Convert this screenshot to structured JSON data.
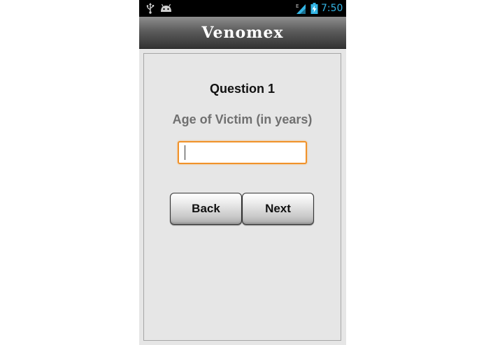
{
  "status_bar": {
    "time": "7:50",
    "icons": [
      "usb-icon",
      "android-icon",
      "signal-e-icon",
      "battery-charging-icon"
    ],
    "time_color": "#33b5e5"
  },
  "app": {
    "title": "Venomex"
  },
  "question": {
    "number": "Question 1",
    "text": "Age of Victim (in years)"
  },
  "answer_input": {
    "value": "",
    "placeholder": "",
    "focus_color": "#f0922a"
  },
  "buttons": {
    "back": "Back",
    "next": "Next"
  },
  "colors": {
    "screen_background": "#e6e6e6",
    "title_bar": "#5c5c5c",
    "question_text": "#707070"
  }
}
